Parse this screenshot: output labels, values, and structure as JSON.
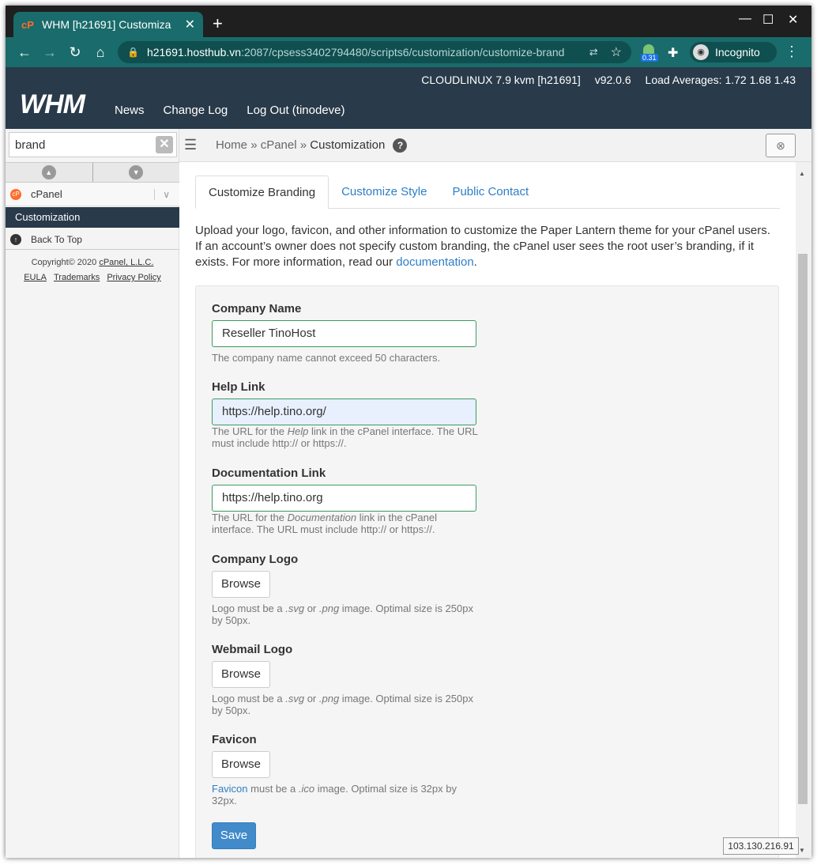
{
  "browser": {
    "tab_title": "WHM [h21691] Customiza",
    "tab_favicon": "cP",
    "url_host": "h21691.hosthub.vn",
    "url_path": ":2087/cpsess3402794480/scripts6/customization/customize-brand",
    "extension_badge": "0.31",
    "incognito_label": "Incognito"
  },
  "header": {
    "os": "CLOUDLINUX 7.9 kvm [h21691]",
    "version": "v92.0.6",
    "load": "Load Averages: 1.72 1.68 1.43",
    "logo": "WHM",
    "nav": [
      "News",
      "Change Log",
      "Log Out (tinodeve)"
    ]
  },
  "sidebar": {
    "search_value": "brand",
    "category": "cPanel",
    "item": "Customization",
    "back_to_top": "Back To Top",
    "copyright_prefix": "Copyright© 2020 ",
    "copyright_company": "cPanel, L.L.C.",
    "links": [
      "EULA",
      "Trademarks",
      "Privacy Policy"
    ]
  },
  "breadcrumb": {
    "home": "Home",
    "sep": "»",
    "cpanel": "cPanel",
    "current": "Customization",
    "help": "?"
  },
  "tabs": [
    "Customize Branding",
    "Customize Style",
    "Public Contact"
  ],
  "intro": {
    "text": "Upload your logo, favicon, and other information to customize the Paper Lantern theme for your cPanel users. If an account’s owner does not specify custom branding, the cPanel user sees the root user’s branding, if it exists. For more information, read our ",
    "link": "documentation",
    "end": "."
  },
  "form": {
    "company_name": {
      "label": "Company Name",
      "value": "Reseller TinoHost",
      "hint": "The company name cannot exceed 50 characters."
    },
    "help_link": {
      "label": "Help Link",
      "value": "https://help.tino.org/",
      "hint_a": "The URL for the ",
      "hint_em": "Help",
      "hint_b": " link in the cPanel interface. The URL must include http:// or https://."
    },
    "documentation_link": {
      "label": "Documentation Link",
      "value": "https://help.tino.org",
      "hint_a": "The URL for the ",
      "hint_em": "Documentation",
      "hint_b": " link in the cPanel interface. The URL must include http:// or https://."
    },
    "company_logo": {
      "label": "Company Logo",
      "button": "Browse",
      "hint_a": "Logo must be a ",
      "hint_em1": ".svg",
      "hint_mid": " or ",
      "hint_em2": ".png",
      "hint_b": " image. Optimal size is 250px by 50px."
    },
    "webmail_logo": {
      "label": "Webmail Logo",
      "button": "Browse",
      "hint_a": "Logo must be a ",
      "hint_em1": ".svg",
      "hint_mid": " or ",
      "hint_em2": ".png",
      "hint_b": " image. Optimal size is 250px by 50px."
    },
    "favicon": {
      "label": "Favicon",
      "button": "Browse",
      "hint_link": "Favicon",
      "hint_a": " must be a ",
      "hint_em": ".ico",
      "hint_b": " image. Optimal size is 32px by 32px."
    },
    "save": "Save"
  },
  "ip_address": "103.130.216.91"
}
